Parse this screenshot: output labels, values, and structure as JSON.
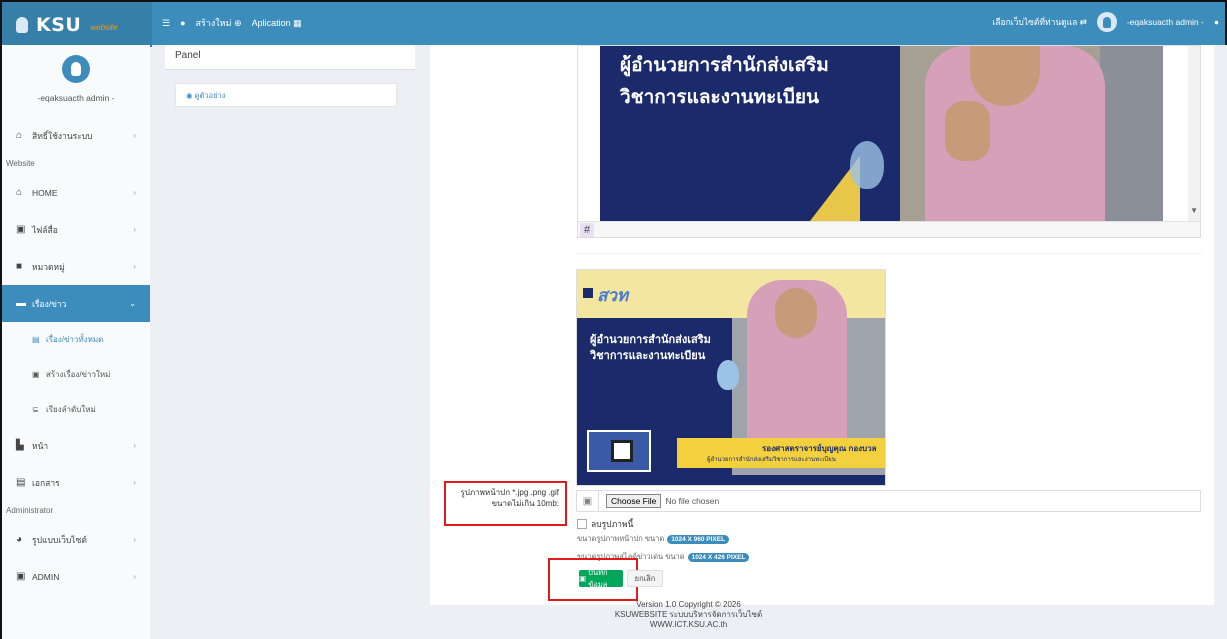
{
  "topbar": {
    "logo_main": "KSU",
    "logo_sub": "website",
    "menu_icon": "hamburger-icon",
    "create_new": "สร้างใหม่",
    "aplication": "Aplication",
    "select_site": "เลือกเว็บไซต์ที่ท่านดูแล",
    "user": "-eqaksuacth admin -"
  },
  "sidebar": {
    "username": "-eqaksuacth admin -",
    "items": [
      {
        "label": "สิทธิ์ใช้งานระบบ",
        "icon": "lock-icon"
      },
      {
        "label": "HOME",
        "icon": "home-icon"
      },
      {
        "label": "ไฟล์สื่อ",
        "icon": "image-icon"
      },
      {
        "label": "หมวดหมู่",
        "icon": "category-icon"
      },
      {
        "label": "เรื่อง/ข่าว",
        "icon": "news-icon"
      },
      {
        "label": "หน้า",
        "icon": "page-icon"
      },
      {
        "label": "เอกสาร",
        "icon": "document-icon"
      },
      {
        "label": "รูปแบบเว็บไซต์",
        "icon": "theme-icon"
      },
      {
        "label": "ADMIN",
        "icon": "admin-icon"
      }
    ],
    "headers": {
      "website": "Website",
      "administrator": "Administrator"
    },
    "submenu": [
      "เรื่อง/ข่าวทั้งหมด",
      "สร้างเรื่อง/ข่าวใหม่",
      "เรียงลำดับใหม่"
    ]
  },
  "panel": {
    "title": "Panel",
    "preview": "ดูตัวอย่าง"
  },
  "banner_large": {
    "title_line1": "ผู้อำนวยการสำนักส่งเสริม",
    "title_line2": "วิชาการและงานทะเบียน"
  },
  "banner_small": {
    "logo": "สวท",
    "title_line1": "ผู้อำนวยการสำนักส่งเสริม",
    "title_line2": "วิชาการและงานทะเบียน",
    "name": "รองศาสตราจารย์บุญคุณ กองบวล",
    "position": "ผู้อำนวยการสำนักส่งเสริมวิชาการและงานทะเบียน"
  },
  "form": {
    "file_label_line1": "รูปภาพหน้าปก *.jpg .png .gif",
    "file_label_line2": "ขนาดไม่เกิน 10mb:",
    "choose_file": "Choose File",
    "no_file": "No file chosen",
    "delete_image": "ลบรูปภาพนี้",
    "cover_size_label": "ขนาดรูปภาพหน้าปก ขนาด",
    "cover_size_badge": "1024 X 960 PIXEL",
    "slide_size_label": "ขนาดรูปภาพสไลด์ข่าวเด่น ขนาด",
    "slide_size_badge": "1024 X 426 PIXEL",
    "save": "บันทึกข้อมูล",
    "cancel": "ยกเลิก"
  },
  "footer": {
    "version": "Version 1.0 Copyright © 2026",
    "system": "KSUWEBSITE ระบบบริหารจัดการเว็บไซต์",
    "url": "WWW.ICT.KSU.AC.th"
  }
}
